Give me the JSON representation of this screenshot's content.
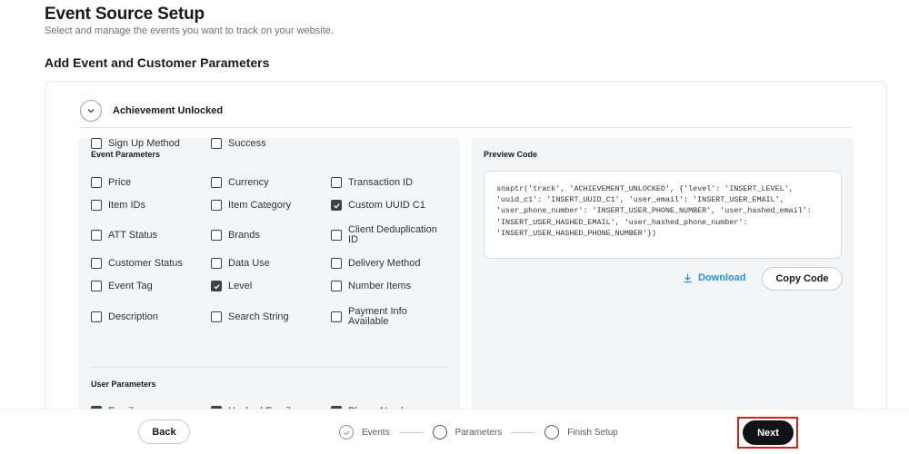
{
  "header": {
    "title": "Event Source Setup",
    "subtitle": "Select and manage the events you want to track on your website.",
    "section_title": "Add Event and Customer Parameters"
  },
  "event": {
    "name": "Achievement Unlocked"
  },
  "event_parameters": {
    "heading": "Event Parameters",
    "items": [
      {
        "label": "Price",
        "checked": false
      },
      {
        "label": "Currency",
        "checked": false
      },
      {
        "label": "Transaction ID",
        "checked": false
      },
      {
        "label": "Item IDs",
        "checked": false
      },
      {
        "label": "Item Category",
        "checked": false
      },
      {
        "label": "Custom UUID C1",
        "checked": true
      },
      {
        "label": "ATT Status",
        "checked": false
      },
      {
        "label": "Brands",
        "checked": false
      },
      {
        "label": "Client Deduplication ID",
        "checked": false
      },
      {
        "label": "Customer Status",
        "checked": false
      },
      {
        "label": "Data Use",
        "checked": false
      },
      {
        "label": "Delivery Method",
        "checked": false
      },
      {
        "label": "Event Tag",
        "checked": false
      },
      {
        "label": "Level",
        "checked": true
      },
      {
        "label": "Number Items",
        "checked": false
      },
      {
        "label": "Description",
        "checked": false
      },
      {
        "label": "Search String",
        "checked": false
      },
      {
        "label": "Payment Info Available",
        "checked": false
      },
      {
        "label": "Sign Up Method",
        "checked": false
      },
      {
        "label": "Success",
        "checked": false
      }
    ]
  },
  "user_parameters": {
    "heading": "User Parameters",
    "items": [
      {
        "label": "Email",
        "checked": true
      },
      {
        "label": "Hashed Email",
        "checked": true
      },
      {
        "label": "Phone Number",
        "checked": true
      }
    ]
  },
  "preview": {
    "heading": "Preview Code",
    "code": "snaptr('track', 'ACHIEVEMENT_UNLOCKED', {'level': 'INSERT_LEVEL', 'uuid_c1': 'INSERT_UUID_C1', 'user_email': 'INSERT_USER_EMAIL', 'user_phone_number': 'INSERT_USER_PHONE_NUMBER', 'user_hashed_email': 'INSERT_USER_HASHED_EMAIL', 'user_hashed_phone_number': 'INSERT_USER_HASHED_PHONE_NUMBER'})",
    "download_label": "Download",
    "copy_label": "Copy Code"
  },
  "footer": {
    "back_label": "Back",
    "next_label": "Next",
    "steps": [
      {
        "label": "Events",
        "state": "done"
      },
      {
        "label": "Parameters",
        "state": "current"
      },
      {
        "label": "Finish Setup",
        "state": "upcoming"
      }
    ]
  },
  "colors": {
    "accent_link": "#2f8fd8",
    "primary_button": "#111315",
    "highlight": "#d71f1f"
  }
}
